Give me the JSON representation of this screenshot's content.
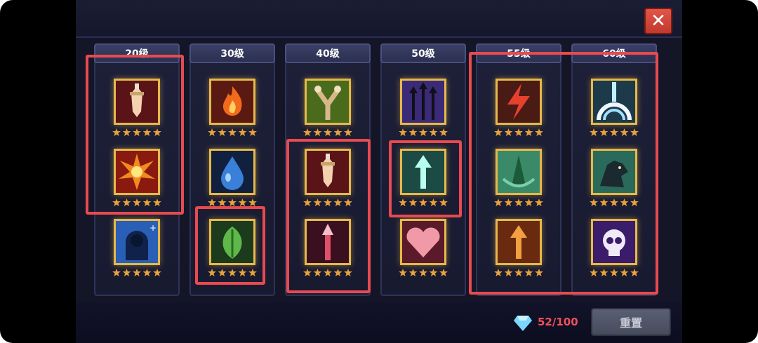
{
  "header": {
    "close_icon": "close-icon"
  },
  "columns": [
    {
      "level": "20级",
      "skills": [
        "sword-icon",
        "burst-icon",
        "shadow-icon"
      ]
    },
    {
      "level": "30级",
      "skills": [
        "fire-icon",
        "water-drop-icon",
        "leaf-icon"
      ]
    },
    {
      "level": "40级",
      "skills": [
        "slingshot-icon",
        "sword-icon",
        "spear-icon"
      ]
    },
    {
      "level": "50级",
      "skills": [
        "triple-arrow-icon",
        "arrow-up-icon",
        "heart-icon"
      ]
    },
    {
      "level": "55级",
      "skills": [
        "lightning-icon",
        "spike-icon",
        "arrow-up-icon"
      ]
    },
    {
      "level": "60级",
      "skills": [
        "light-wave-icon",
        "wolf-icon",
        "skull-icon"
      ]
    }
  ],
  "footer": {
    "gem_count": "52/100",
    "reset_label": "重置"
  },
  "colors": {
    "highlight": "#e84a4f",
    "gold": "#e6b94a",
    "star": "#e9a23a"
  }
}
